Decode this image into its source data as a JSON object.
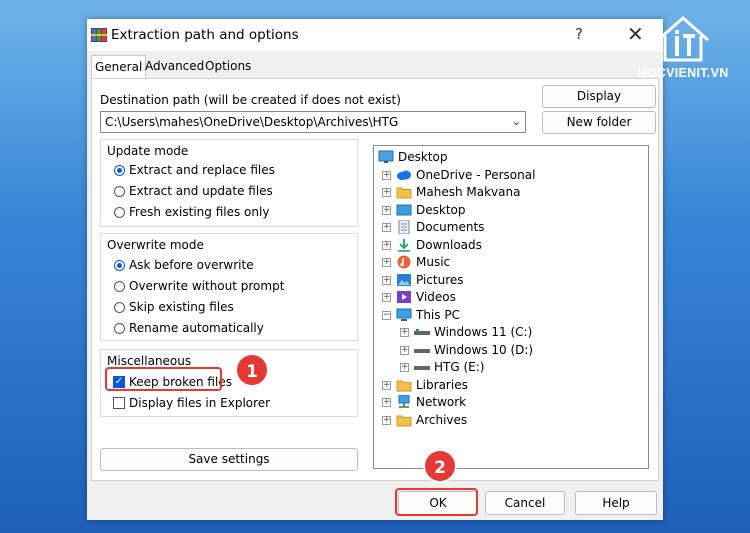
{
  "dialog": {
    "title": "Extraction path and options",
    "help_glyph": "?",
    "close_glyph": "✕"
  },
  "tabs": [
    {
      "label": "General",
      "active": true
    },
    {
      "label": "Advanced",
      "active": false
    },
    {
      "label": "Options",
      "active": false
    }
  ],
  "destination": {
    "label": "Destination path (will be created if does not exist)",
    "value": "C:\\Users\\mahes\\OneDrive\\Desktop\\Archives\\HTG",
    "dropdown_glyph": "⌄"
  },
  "buttons": {
    "display": "Display",
    "new_folder": "New folder",
    "save_settings": "Save settings",
    "ok": "OK",
    "cancel": "Cancel",
    "help": "Help"
  },
  "update_mode": {
    "title": "Update mode",
    "options": [
      {
        "label": "Extract and replace files",
        "selected": true
      },
      {
        "label": "Extract and update files",
        "selected": false
      },
      {
        "label": "Fresh existing files only",
        "selected": false
      }
    ]
  },
  "overwrite_mode": {
    "title": "Overwrite mode",
    "options": [
      {
        "label": "Ask before overwrite",
        "selected": true
      },
      {
        "label": "Overwrite without prompt",
        "selected": false
      },
      {
        "label": "Skip existing files",
        "selected": false
      },
      {
        "label": "Rename automatically",
        "selected": false
      }
    ]
  },
  "miscellaneous": {
    "title": "Miscellaneous",
    "options": [
      {
        "label": "Keep broken files",
        "checked": true
      },
      {
        "label": "Display files in Explorer",
        "checked": false
      }
    ]
  },
  "tree": {
    "root": "Desktop",
    "items": [
      {
        "label": "OneDrive - Personal",
        "icon": "cloud-icon",
        "expanded": false
      },
      {
        "label": "Mahesh Makvana",
        "icon": "user-folder-icon",
        "expanded": false
      },
      {
        "label": "Desktop",
        "icon": "desktop-folder-icon",
        "expanded": false
      },
      {
        "label": "Documents",
        "icon": "documents-icon",
        "expanded": false
      },
      {
        "label": "Downloads",
        "icon": "downloads-icon",
        "expanded": false
      },
      {
        "label": "Music",
        "icon": "music-icon",
        "expanded": false
      },
      {
        "label": "Pictures",
        "icon": "pictures-icon",
        "expanded": false
      },
      {
        "label": "Videos",
        "icon": "videos-icon",
        "expanded": false
      },
      {
        "label": "This PC",
        "icon": "pc-icon",
        "expanded": true
      },
      {
        "label": "Windows 11 (C:)",
        "icon": "drive-icon",
        "expanded": false
      },
      {
        "label": "Windows 10 (D:)",
        "icon": "drive-icon",
        "expanded": false
      },
      {
        "label": "HTG (E:)",
        "icon": "drive-icon",
        "expanded": false
      },
      {
        "label": "Libraries",
        "icon": "libraries-icon",
        "expanded": false
      },
      {
        "label": "Network",
        "icon": "network-icon",
        "expanded": false
      },
      {
        "label": "Archives",
        "icon": "folder-icon",
        "expanded": false
      }
    ]
  },
  "annotations": {
    "step1": "1",
    "step2": "2",
    "highlight_color": "#e53935"
  },
  "watermark": {
    "text": "HOCVIENIT.VN"
  }
}
